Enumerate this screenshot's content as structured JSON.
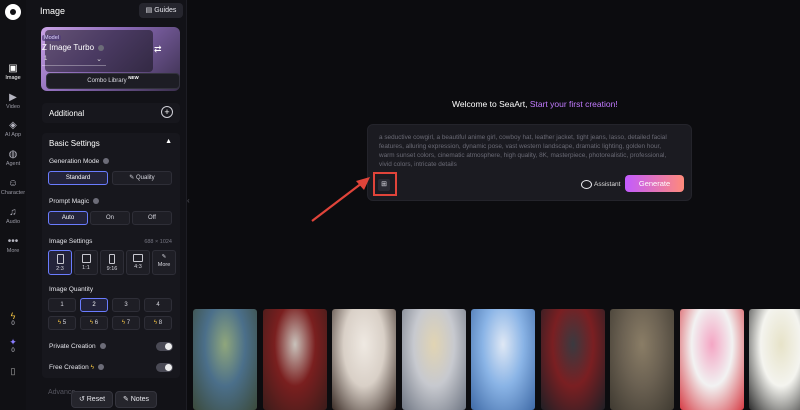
{
  "rail": {
    "items": [
      {
        "label": "Image",
        "icon": "image-icon",
        "active": true
      },
      {
        "label": "Video",
        "icon": "video-icon"
      },
      {
        "label": "AI App",
        "icon": "ai-app-icon"
      },
      {
        "label": "Agent",
        "icon": "agent-icon"
      },
      {
        "label": "Character",
        "icon": "character-icon"
      },
      {
        "label": "Audio",
        "icon": "audio-icon"
      },
      {
        "label": "More",
        "icon": "more-icon"
      }
    ],
    "stamina": "0",
    "credits": "0"
  },
  "panel": {
    "title": "Image",
    "guides_label": "Guides",
    "model": {
      "tag": "Model",
      "name": "Z Image Turbo",
      "count": "1"
    },
    "combo_label": "Combo Library",
    "combo_badge": "NEW",
    "additional_label": "Additional",
    "basic_label": "Basic Settings",
    "generation_mode": {
      "label": "Generation Mode",
      "options": [
        "Standard",
        "Quality"
      ],
      "selected": "Standard"
    },
    "prompt_magic": {
      "label": "Prompt Magic",
      "options": [
        "Auto",
        "On",
        "Off"
      ],
      "selected": "Auto"
    },
    "image_settings": {
      "label": "Image Settings",
      "dims": "688 × 1024",
      "ratios": [
        "2:3",
        "1:1",
        "9:16",
        "4:3",
        "More"
      ],
      "selected": "2:3"
    },
    "image_quantity": {
      "label": "Image Quantity",
      "options": [
        "1",
        "2",
        "3",
        "4"
      ],
      "selected": "2",
      "costs": [
        "5",
        "6",
        "7",
        "8"
      ]
    },
    "private_creation": "Private Creation",
    "free_creation": "Free Creation",
    "advanced_label": "Advance",
    "reset_label": "Reset",
    "notes_label": "Notes"
  },
  "main": {
    "welcome": "Welcome to SeaArt,",
    "welcome_accent": "Start your first creation!",
    "prompt_placeholder": "a seductive cowgirl, a beautiful anime girl, cowboy hat, leather jacket, tight jeans, lasso, detailed facial features, alluring expression, dynamic pose, vast western landscape, dramatic lighting, golden hour, warm sunset colors, cinematic atmosphere, high quality, 8K, masterpiece, photorealistic, professional, vivid colors, intricate details",
    "assistant_label": "Assistant",
    "generate_label": "Generate",
    "accent_color": "#c27bff",
    "highlight_color": "#e0443a"
  },
  "gallery": [
    {
      "name": "fantasy-castle",
      "colors": [
        "#4b6f8a",
        "#8fa67c",
        "#3b4a3a"
      ]
    },
    {
      "name": "red-haired-wolf-girl",
      "colors": [
        "#7a1f1f",
        "#c9c2bb",
        "#3a1c1a"
      ]
    },
    {
      "name": "woman-white-sweater",
      "colors": [
        "#d9d0c7",
        "#efe9e2",
        "#3a2c26"
      ]
    },
    {
      "name": "blonde-uniform-girl",
      "colors": [
        "#c7c9cf",
        "#e1d4b3",
        "#6e7582"
      ]
    },
    {
      "name": "anime-blue-hair-girl",
      "colors": [
        "#8ab4e6",
        "#dfe8f5",
        "#3f6aa6"
      ]
    },
    {
      "name": "armored-warrior",
      "colors": [
        "#7a1f22",
        "#3a3a40",
        "#1f1f25"
      ]
    },
    {
      "name": "soldier-painting",
      "colors": [
        "#6b6152",
        "#8a7d66",
        "#3f3a31"
      ]
    },
    {
      "name": "pink-hair-anime-girl",
      "colors": [
        "#f2f2f2",
        "#f4a6c4",
        "#d63b44"
      ]
    },
    {
      "name": "girl-with-flowers",
      "colors": [
        "#f4f4ef",
        "#e7e3c9",
        "#2b2b2b"
      ]
    }
  ]
}
